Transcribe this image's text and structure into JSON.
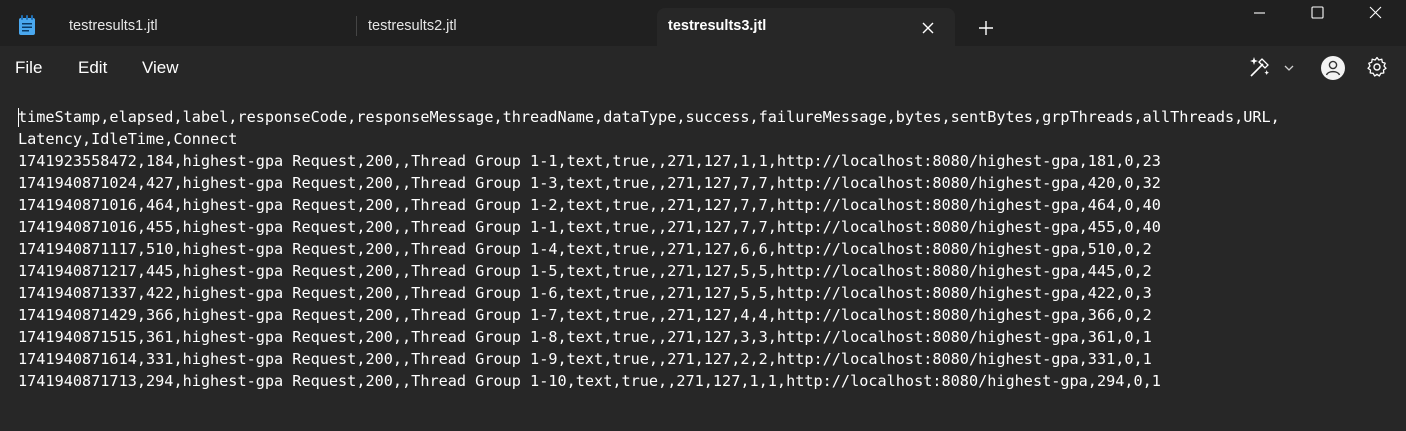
{
  "tabs": [
    {
      "label": "testresults1.jtl",
      "active": false
    },
    {
      "label": "testresults2.jtl",
      "active": false
    },
    {
      "label": "testresults3.jtl",
      "active": true
    }
  ],
  "menu": {
    "file": "File",
    "edit": "Edit",
    "view": "View"
  },
  "icons": {
    "app": "notepad-icon",
    "close_tab": "close-icon",
    "new_tab": "plus-icon",
    "copilot": "copilot-sparkle-icon",
    "account": "account-icon",
    "settings": "gear-icon"
  },
  "colors": {
    "titlebar": "#202020",
    "editor_bg": "#272727",
    "text": "#ffffff",
    "app_icon": "#4aa8ef"
  },
  "editor": {
    "lines": [
      "timeStamp,elapsed,label,responseCode,responseMessage,threadName,dataType,success,failureMessage,bytes,sentBytes,grpThreads,allThreads,URL,",
      "Latency,IdleTime,Connect",
      "1741923558472,184,highest-gpa Request,200,,Thread Group 1-1,text,true,,271,127,1,1,http://localhost:8080/highest-gpa,181,0,23",
      "1741940871024,427,highest-gpa Request,200,,Thread Group 1-3,text,true,,271,127,7,7,http://localhost:8080/highest-gpa,420,0,32",
      "1741940871016,464,highest-gpa Request,200,,Thread Group 1-2,text,true,,271,127,7,7,http://localhost:8080/highest-gpa,464,0,40",
      "1741940871016,455,highest-gpa Request,200,,Thread Group 1-1,text,true,,271,127,7,7,http://localhost:8080/highest-gpa,455,0,40",
      "1741940871117,510,highest-gpa Request,200,,Thread Group 1-4,text,true,,271,127,6,6,http://localhost:8080/highest-gpa,510,0,2",
      "1741940871217,445,highest-gpa Request,200,,Thread Group 1-5,text,true,,271,127,5,5,http://localhost:8080/highest-gpa,445,0,2",
      "1741940871337,422,highest-gpa Request,200,,Thread Group 1-6,text,true,,271,127,5,5,http://localhost:8080/highest-gpa,422,0,3",
      "1741940871429,366,highest-gpa Request,200,,Thread Group 1-7,text,true,,271,127,4,4,http://localhost:8080/highest-gpa,366,0,2",
      "1741940871515,361,highest-gpa Request,200,,Thread Group 1-8,text,true,,271,127,3,3,http://localhost:8080/highest-gpa,361,0,1",
      "1741940871614,331,highest-gpa Request,200,,Thread Group 1-9,text,true,,271,127,2,2,http://localhost:8080/highest-gpa,331,0,1",
      "1741940871713,294,highest-gpa Request,200,,Thread Group 1-10,text,true,,271,127,1,1,http://localhost:8080/highest-gpa,294,0,1"
    ]
  }
}
